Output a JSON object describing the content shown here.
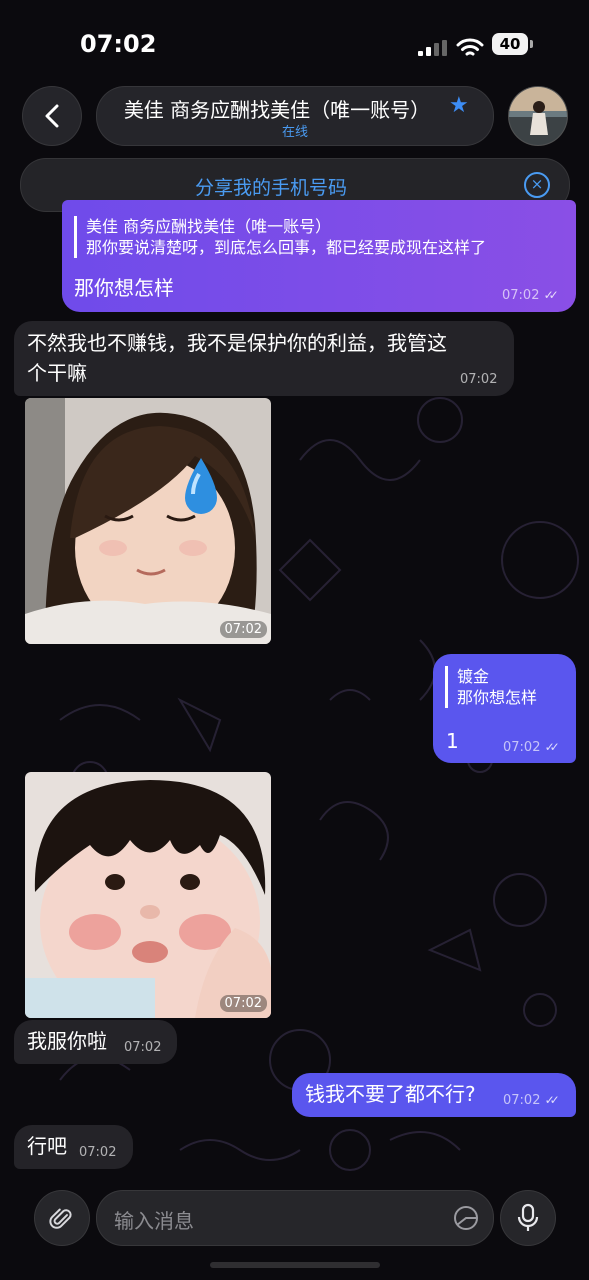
{
  "status_bar": {
    "time": "07:02",
    "battery": "40"
  },
  "header": {
    "contact_name": "美佳 商务应酬找美佳（唯一账号）",
    "presence": "在线"
  },
  "share_banner": {
    "label": "分享我的手机号码"
  },
  "messages": [
    {
      "direction": "out",
      "reply_to_name": "美佳 商务应酬找美佳（唯一账号）",
      "reply_to_text": "那你要说清楚呀，到底怎么回事，都已经要成现在这样了",
      "text": "那你想怎样",
      "time": "07:02"
    },
    {
      "direction": "in",
      "text_line1": "不然我也不赚钱，我不是保护你的利益，我管这",
      "text_line2": "个干嘛",
      "time": "07:02"
    },
    {
      "direction": "in",
      "type": "photo",
      "time": "07:02"
    },
    {
      "direction": "out",
      "reply_to_name": "镀金",
      "reply_to_text": "那你想怎样",
      "text": "1",
      "time": "07:02"
    },
    {
      "direction": "in",
      "type": "photo",
      "time": "07:02"
    },
    {
      "direction": "in",
      "text": "我服你啦",
      "time": "07:02"
    },
    {
      "direction": "out",
      "text": "钱我不要了都不行?",
      "time": "07:02"
    },
    {
      "direction": "in",
      "text": "行吧",
      "time": "07:02"
    }
  ],
  "composer": {
    "placeholder": "输入消息"
  },
  "colors": {
    "accent_blue": "#4a9bf2",
    "outgoing_purple": "#7a4de8",
    "incoming_gray": "#242328"
  }
}
